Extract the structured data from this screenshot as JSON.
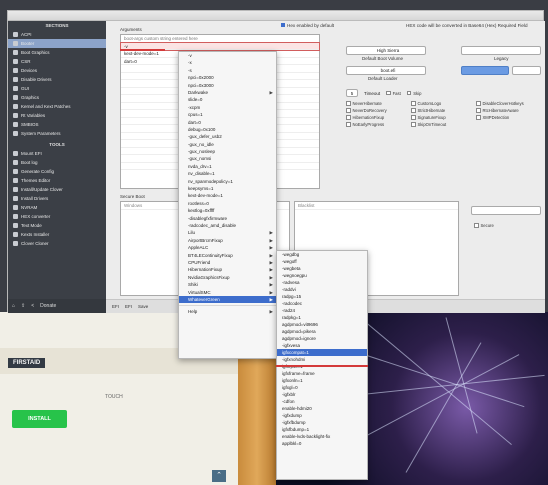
{
  "desktop": {
    "panel_label": "FIRSTAID",
    "tag_label": "TOUCH",
    "green_button": "INSTALL"
  },
  "window": {
    "sidebar": {
      "section1_title": "SECTIONS",
      "items1": [
        "ACPI",
        "Booter",
        "Boot Graphics",
        "CSR",
        "Devices",
        "Disable Drivers",
        "GUI",
        "Graphics",
        "Kernel and Kext Patches",
        "Rt Variables",
        "SMBIOS",
        "System Parameters"
      ],
      "selected_index": 1,
      "section2_title": "TOOLS",
      "items2": [
        "Mount EFI",
        "Boot log",
        "Generate Config",
        "Themes Editor",
        "Install/Update Clover",
        "Install Drivers",
        "NVRAM",
        "HEX converter",
        "Text Mode",
        "Kexts Installer",
        "Clover Cloner"
      ],
      "footer_label": "Donate"
    },
    "main": {
      "arguments_label": "Arguments",
      "arguments_value": "boot-args custom string entered here",
      "args_list": [
        "-v",
        "kext-dev-mode=1",
        "dart=0"
      ],
      "legacy_label": "Legacy",
      "default_boot_volume_label": "Default Boot Volume",
      "default_boot_volume_value": "High Sierra",
      "default_loader_label": "Default Loader",
      "default_loader_value": "boot.efi",
      "hex_note": "Hex enabled by default",
      "hex_text": "HEX code will be converted in Base64 (Hex)   Required Field",
      "timeout_label": "Timeout",
      "timeout_value": "5",
      "fast_label": "Fast",
      "skip_label": "Skip",
      "checkboxes": [
        "NeverHibernate",
        "CustomLogo",
        "DisableCloverHotkeys",
        "NeverDoRecovery",
        "StrictHibernate",
        "RtcHibernateAware",
        "HibernationFixup",
        "SignatureFixup",
        "XMPDetection",
        "NoEarlyProgress",
        "SkipOnTimeout"
      ],
      "secure_boot_label": "Secure Boot",
      "secure_value": "Windows",
      "blocklist_label": "Blacklist",
      "secure_checkbox": "Secure"
    },
    "bottom_bar": [
      "EFI",
      "EFI",
      "Save"
    ]
  },
  "context_menu": {
    "items": [
      {
        "label": "-v",
        "arrow": false
      },
      {
        "label": "-x",
        "arrow": false
      },
      {
        "label": "-s",
        "arrow": false
      },
      {
        "label": "npci=0x2000",
        "arrow": false
      },
      {
        "label": "npci=0x3000",
        "arrow": false
      },
      {
        "label": "Darkwake",
        "arrow": true
      },
      {
        "label": "slide=0",
        "arrow": false
      },
      {
        "label": "-xcpm",
        "arrow": false
      },
      {
        "label": "cpus=1",
        "arrow": false
      },
      {
        "label": "dart=0",
        "arrow": false
      },
      {
        "label": "debug=0x100",
        "arrow": false
      },
      {
        "label": "-gux_defer_usb2",
        "arrow": false
      },
      {
        "label": "-gux_no_idle",
        "arrow": false
      },
      {
        "label": "-gux_nosleep",
        "arrow": false
      },
      {
        "label": "-gux_nomsi",
        "arrow": false
      },
      {
        "label": "nvda_drv=1",
        "arrow": false
      },
      {
        "label": "nv_disable=1",
        "arrow": false
      },
      {
        "label": "nv_spanmodepolicy=1",
        "arrow": false
      },
      {
        "label": "keepsyms=1",
        "arrow": false
      },
      {
        "label": "kext-dev-mode=1",
        "arrow": false
      },
      {
        "label": "rootless=0",
        "arrow": false
      },
      {
        "label": "kextlog=0xffff",
        "arrow": false
      },
      {
        "label": "-disablegfxfirmware",
        "arrow": false
      },
      {
        "label": "-radcodec_amd_disable",
        "arrow": false
      },
      {
        "label": "Lilu",
        "arrow": true
      },
      {
        "label": "AirportBrcmFixup",
        "arrow": true
      },
      {
        "label": "AppleALC",
        "arrow": true
      },
      {
        "label": "BT4LEContinuityFixup",
        "arrow": true
      },
      {
        "label": "CPUFriend",
        "arrow": true
      },
      {
        "label": "HibernationFixup",
        "arrow": true
      },
      {
        "label": "NvidiaGraphicsFixup",
        "arrow": true
      },
      {
        "label": "Shiki",
        "arrow": true
      },
      {
        "label": "VirtualSMC",
        "arrow": true
      },
      {
        "label": "WhateverGreen",
        "arrow": true
      },
      {
        "label": "sep",
        "arrow": false
      },
      {
        "label": "Help",
        "arrow": true
      }
    ],
    "highlighted": "WhateverGreen"
  },
  "submenu": {
    "items": [
      "-wegdbg",
      "-wegoff",
      "-wegbeta",
      "-wegnoegpu",
      "-radvesa",
      "-raddvi",
      "radpg=15",
      "-radcodec",
      "-rad24",
      "radpkg=1",
      "agdpmod=vit9696",
      "agdpmod=pikera",
      "agdpmod=ignore",
      "-igfxvesa",
      "igfxcompat=1",
      "-igfxnohdmi",
      "igfxrpsc=1",
      "igfxframe=frame",
      "igfxonln=1",
      "igfxgl=0",
      "-igfxblr",
      "-cdfon",
      "enable-hdmi20",
      "-igfxdump",
      "-igfxfbdump",
      "igfxfbdump=1",
      "enable-lvds-backlight-fix",
      "applbkl=0"
    ],
    "highlighted": "igfxcompat=1"
  }
}
